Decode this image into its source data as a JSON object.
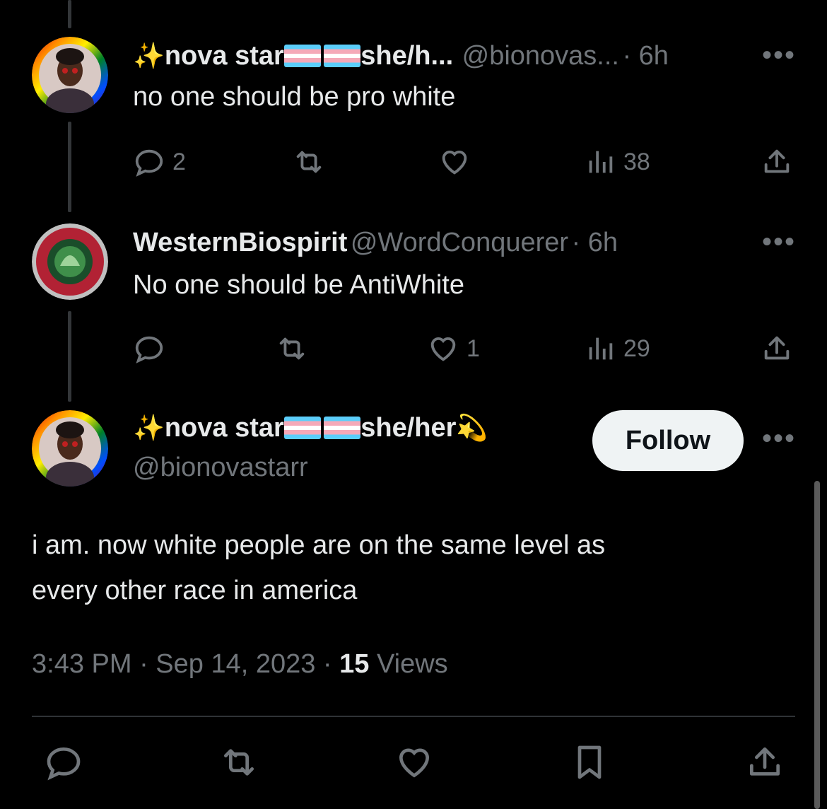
{
  "tweets": [
    {
      "display_name": "nova star",
      "pronouns": "she/h...",
      "handle": "@bionovas...",
      "time": "· 6h",
      "text": "no one should be pro white",
      "replies": "2",
      "reposts": "",
      "likes": "",
      "views": "38"
    },
    {
      "display_name": "WesternBiospirit",
      "handle": "@WordConquerer",
      "time": "· 6h",
      "text": "No one should be AntiWhite",
      "replies": "",
      "reposts": "",
      "likes": "1",
      "views": "29"
    }
  ],
  "main_tweet": {
    "display_name": "nova star",
    "pronouns": "she/her",
    "handle": "@bionovastarr",
    "follow_label": "Follow",
    "text_line1": "i am. now white people are on the same level as",
    "text_line2": "every other race in america",
    "time": "3:43 PM · Sep 14, 2023 · ",
    "views_count": "15",
    "views_label": " Views"
  },
  "emoji": {
    "sparkles": "✨",
    "dizzy": "💫"
  },
  "colors": {
    "background": "#000000",
    "text": "#e7e9ea",
    "secondary": "#71767b",
    "follow_bg": "#eff3f4"
  }
}
